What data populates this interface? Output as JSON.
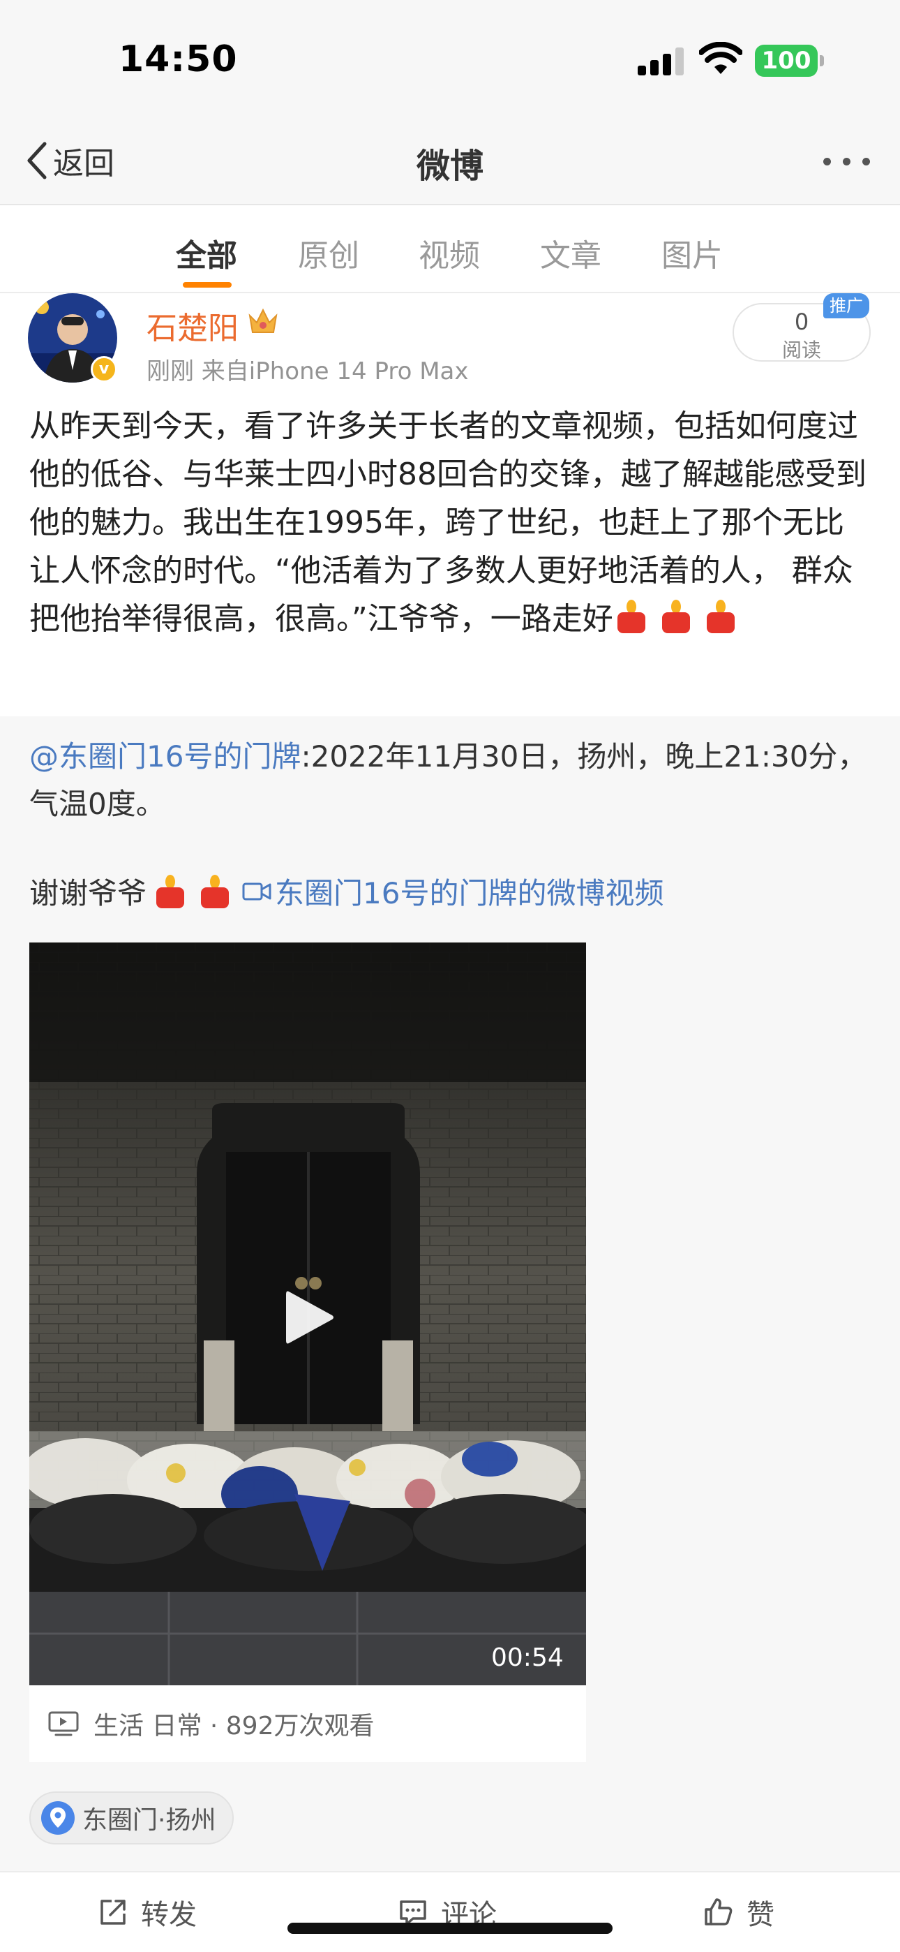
{
  "status": {
    "time": "14:50",
    "battery": "100"
  },
  "nav": {
    "back_label": "返回",
    "title": "微博"
  },
  "tabs": [
    {
      "label": "全部",
      "active": true
    },
    {
      "label": "原创"
    },
    {
      "label": "视频"
    },
    {
      "label": "文章"
    },
    {
      "label": "图片"
    }
  ],
  "post": {
    "username": "石楚阳",
    "meta": "刚刚 来自iPhone 14 Pro Max",
    "read_count": "0",
    "read_label": "阅读",
    "ad_tag": "推广",
    "text": "从昨天到今天，看了许多关于长者的文章视频，包括如何度过他的低谷、与华莱士四小时88回合的交锋，越了解越能感受到他的魅力。我出生在1995年，跨了世纪，也赶上了那个无比让人怀念的时代。“他活着为了多数人更好地活着的人， 群众把他抬举得很高，很高。”江爷爷，一路走好"
  },
  "retweet": {
    "author_link": "@东圈门16号的门牌",
    "text": ":2022年11月30日，扬州，晚上21:30分，气温0度。",
    "thanks": "谢谢爷爷",
    "video_link": "东圈门16号的门牌的微博视频",
    "video_duration": "00:54",
    "video_info": "生活 日常 · 892万次观看",
    "location": "东圈门·扬州"
  },
  "actions": {
    "repost": "转发",
    "comment": "评论",
    "like": "赞"
  },
  "colors": {
    "accent": "#ff8200",
    "link": "#4a7ac0",
    "username": "#eb6b2f",
    "battery": "#35c759"
  }
}
